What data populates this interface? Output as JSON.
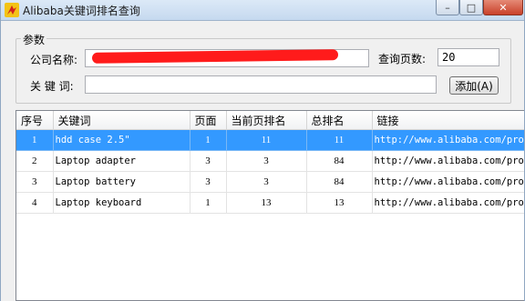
{
  "window": {
    "title": "Alibaba关键词排名查询",
    "minimize_glyph": "–",
    "maximize_glyph": "□",
    "close_glyph": "✕"
  },
  "params": {
    "group_label": "参数",
    "company_label": "公司名称:",
    "company_value_partial": "--",
    "pages_label": "查询页数:",
    "pages_value": "20",
    "keyword_label": "关 键 词:",
    "keyword_value": "",
    "add_button": "添加(A)"
  },
  "table": {
    "columns": [
      "序号",
      "关键词",
      "页面",
      "当前页排名",
      "总排名",
      "链接"
    ],
    "rows": [
      {
        "no": "1",
        "keyword": "hdd case 2.5\"",
        "page": "1",
        "current_rank": "11",
        "total_rank": "11",
        "link": "http://www.alibaba.com/pro",
        "selected": true
      },
      {
        "no": "2",
        "keyword": "Laptop adapter",
        "page": "3",
        "current_rank": "3",
        "total_rank": "84",
        "link": "http://www.alibaba.com/pro",
        "selected": false
      },
      {
        "no": "3",
        "keyword": "Laptop battery",
        "page": "3",
        "current_rank": "3",
        "total_rank": "84",
        "link": "http://www.alibaba.com/pro",
        "selected": false
      },
      {
        "no": "4",
        "keyword": "Laptop keyboard",
        "page": "1",
        "current_rank": "13",
        "total_rank": "13",
        "link": "http://www.alibaba.com/pro",
        "selected": false
      }
    ]
  },
  "colors": {
    "selection": "#3399ff",
    "redaction": "#ff1b1b"
  }
}
